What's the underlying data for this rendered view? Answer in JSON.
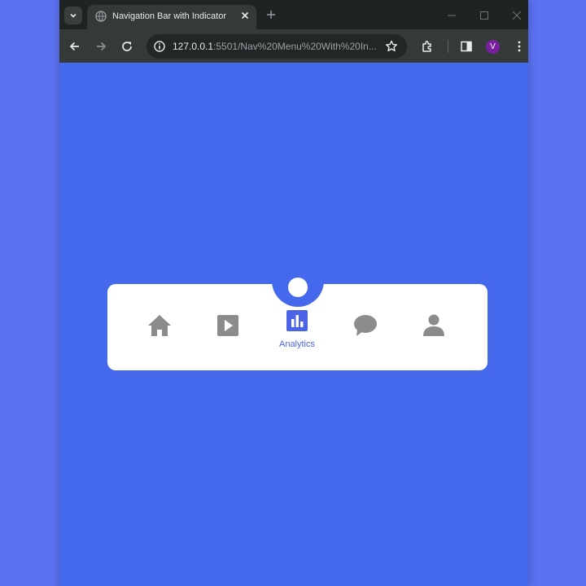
{
  "browser": {
    "tab_title": "Navigation Bar with Indicator",
    "url_host": "127.0.0.1",
    "url_rest": ":5501/Nav%20Menu%20With%20In...",
    "profile_initial": "V"
  },
  "nav": {
    "active_index": 2,
    "items": [
      {
        "icon": "home-icon",
        "label": "Home"
      },
      {
        "icon": "play-icon",
        "label": "Video"
      },
      {
        "icon": "analytics-icon",
        "label": "Analytics"
      },
      {
        "icon": "chat-icon",
        "label": "Messages"
      },
      {
        "icon": "person-icon",
        "label": "Profile"
      }
    ],
    "active_label": "Analytics"
  },
  "colors": {
    "page_bg": "#5b72f1",
    "viewport_bg": "#4469ec",
    "accent": "#4a63e7",
    "icon_inactive": "#8c8c8c",
    "card_bg": "#ffffff"
  }
}
